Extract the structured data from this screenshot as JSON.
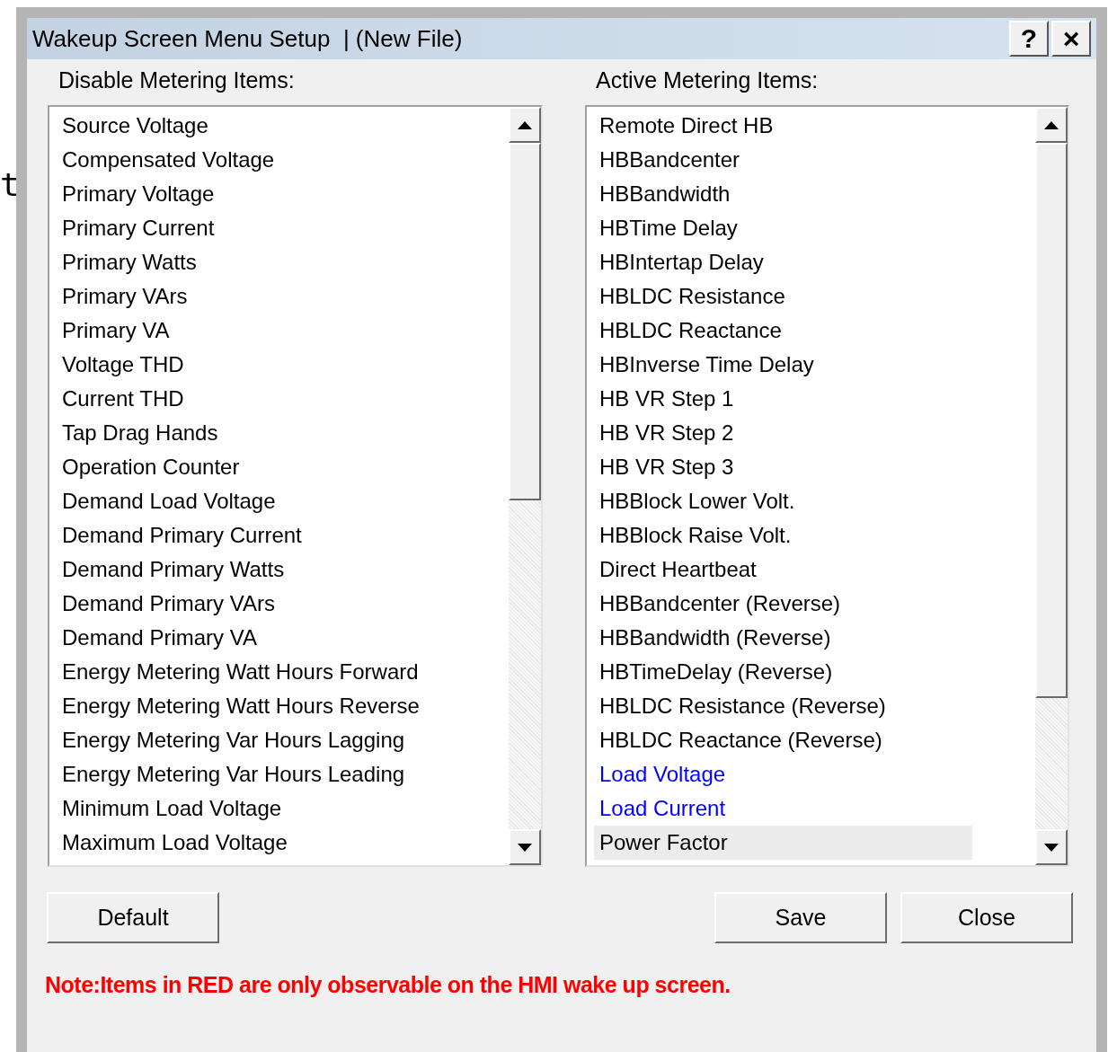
{
  "background_text": "t",
  "window": {
    "title": "Wakeup Screen Menu Setup  | (New File)",
    "buttons": [
      "?",
      "×"
    ]
  },
  "lists": [
    {
      "label": "Disable Metering Items:",
      "items": [
        {
          "text": "Source Voltage",
          "selected": false
        },
        {
          "text": "Compensated Voltage",
          "selected": false
        },
        {
          "text": "Primary Voltage",
          "selected": false
        },
        {
          "text": "Primary Current",
          "selected": false
        },
        {
          "text": "Primary Watts",
          "selected": false
        },
        {
          "text": "Primary VArs",
          "selected": false
        },
        {
          "text": "Primary VA",
          "selected": false
        },
        {
          "text": "Voltage THD",
          "selected": false
        },
        {
          "text": "Current THD",
          "selected": false
        },
        {
          "text": "Tap Drag Hands",
          "selected": false
        },
        {
          "text": "Operation Counter",
          "selected": false
        },
        {
          "text": "Demand Load Voltage",
          "selected": false
        },
        {
          "text": "Demand Primary Current",
          "selected": false
        },
        {
          "text": "Demand Primary Watts",
          "selected": false
        },
        {
          "text": "Demand Primary VArs",
          "selected": false
        },
        {
          "text": "Demand Primary VA",
          "selected": false
        },
        {
          "text": "Energy Metering Watt Hours Forward",
          "selected": false
        },
        {
          "text": "Energy Metering Watt Hours Reverse",
          "selected": false
        },
        {
          "text": "Energy Metering Var Hours Lagging",
          "selected": false
        },
        {
          "text": "Energy Metering Var Hours Leading",
          "selected": false
        },
        {
          "text": "Minimum Load Voltage",
          "selected": false
        },
        {
          "text": "Maximum Load Voltage",
          "selected": false
        }
      ]
    },
    {
      "label": "Active Metering Items:",
      "items": [
        {
          "text": "Remote Direct HB",
          "selected": false,
          "color": "#000000"
        },
        {
          "text": "HBBandcenter",
          "selected": false,
          "color": "#000000"
        },
        {
          "text": "HBBandwidth",
          "selected": false,
          "color": "#000000"
        },
        {
          "text": "HBTime Delay",
          "selected": false,
          "color": "#000000"
        },
        {
          "text": "HBIntertap Delay",
          "selected": false,
          "color": "#000000"
        },
        {
          "text": "HBLDC Resistance",
          "selected": false,
          "color": "#000000"
        },
        {
          "text": "HBLDC Reactance",
          "selected": false,
          "color": "#000000"
        },
        {
          "text": "HBInverse Time Delay",
          "selected": false,
          "color": "#000000"
        },
        {
          "text": "HB VR Step 1",
          "selected": false,
          "color": "#000000"
        },
        {
          "text": "HB VR Step 2",
          "selected": false,
          "color": "#000000"
        },
        {
          "text": "HB VR Step 3",
          "selected": false,
          "color": "#000000"
        },
        {
          "text": "HBBlock Lower Volt.",
          "selected": false,
          "color": "#000000"
        },
        {
          "text": "HBBlock Raise Volt.",
          "selected": false,
          "color": "#000000"
        },
        {
          "text": "Direct Heartbeat",
          "selected": false,
          "color": "#000000"
        },
        {
          "text": "HBBandcenter (Reverse)",
          "selected": false,
          "color": "#000000"
        },
        {
          "text": "HBBandwidth (Reverse)",
          "selected": false,
          "color": "#000000"
        },
        {
          "text": "HBTimeDelay (Reverse)",
          "selected": false,
          "color": "#000000"
        },
        {
          "text": "HBLDC Resistance (Reverse)",
          "selected": false,
          "color": "#000000"
        },
        {
          "text": "HBLDC Reactance (Reverse)",
          "selected": false,
          "color": "#000000"
        },
        {
          "text": "Load Voltage",
          "selected": false,
          "color": "#0000ff"
        },
        {
          "text": "Load Current",
          "selected": false,
          "color": "#0000ff"
        },
        {
          "text": "Power Factor",
          "selected": true,
          "color": "#000000"
        }
      ]
    }
  ],
  "buttons": [
    "Default",
    "Save",
    "Close"
  ],
  "note": "Note:Items in RED are only observable on the HMI wake up screen."
}
